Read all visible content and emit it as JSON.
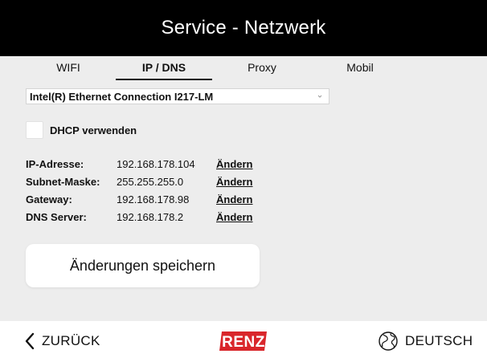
{
  "header": {
    "title": "Service - Netzwerk"
  },
  "tabs": [
    {
      "label": "WIFI",
      "active": false
    },
    {
      "label": "IP / DNS",
      "active": true
    },
    {
      "label": "Proxy",
      "active": false
    },
    {
      "label": "Mobil",
      "active": false
    }
  ],
  "adapter_select": {
    "value": "Intel(R) Ethernet Connection I217-LM"
  },
  "dhcp": {
    "label": "DHCP verwenden",
    "checked": false
  },
  "network": [
    {
      "label": "IP-Adresse:",
      "value": "192.168.178.104",
      "action": "Ändern"
    },
    {
      "label": "Subnet-Maske:",
      "value": "255.255.255.0",
      "action": "Ändern"
    },
    {
      "label": "Gateway:",
      "value": "192.168.178.98",
      "action": "Ändern"
    },
    {
      "label": "DNS Server:",
      "value": "192.168.178.2",
      "action": "Ändern"
    }
  ],
  "save_button": {
    "label": "Änderungen speichern"
  },
  "footer": {
    "back_label": "ZURÜCK",
    "logo_text": "RENZ",
    "language_label": "DEUTSCH"
  },
  "colors": {
    "header_bg": "#000000",
    "content_bg": "#ededed",
    "brand_red": "#d9262b"
  },
  "icons": {
    "back": "chevron-left-icon",
    "dropdown": "chevron-down-icon",
    "language": "globe-icon"
  }
}
